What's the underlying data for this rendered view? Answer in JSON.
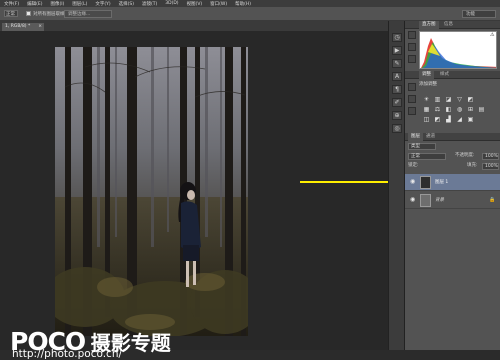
{
  "menu": [
    "文件(F)",
    "编辑(E)",
    "图像(I)",
    "图层(L)",
    "文字(Y)",
    "选择(S)",
    "滤镜(T)",
    "3D(D)",
    "视图(V)",
    "窗口(W)",
    "帮助(H)"
  ],
  "options": {
    "mode_value": "正常",
    "sample_all_layers_label": "对所有图层取样",
    "sample_all_layers_checked": true,
    "refine_button": "调整边缘..."
  },
  "workspace": {
    "selected": "功能"
  },
  "document": {
    "tab_label": "1, RGB/8) *",
    "close_glyph": "×"
  },
  "watermark": {
    "logo": "POCO",
    "subtitle": "摄影专题",
    "url": "http://photo.poco.cn/"
  },
  "annotation": {
    "arrow_color": "#ffee00",
    "points_to": "layer-1"
  },
  "panels": {
    "histogram_tabs": [
      "直方图",
      "信息"
    ],
    "warning_glyph": "⚠",
    "adjustments_tabs": [
      "调整",
      "样式"
    ],
    "adjustments_title": "添加调整",
    "adjust_icons_row1": [
      "☀",
      "▥",
      "◪",
      "▽",
      "◩"
    ],
    "adjust_icons_row2": [
      "▦",
      "⚖",
      "◧",
      "◍",
      "⊞",
      "▤"
    ],
    "adjust_icons_row3": [
      "◫",
      "◩",
      "▟",
      "◢",
      "▣"
    ],
    "layers_tabs": [
      "图层",
      "通道"
    ],
    "kind_label": "类型",
    "blend_mode": "正常",
    "opacity_label": "不透明度:",
    "opacity_value": "100%",
    "lock_label": "锁定:",
    "fill_label": "填充:",
    "fill_value": "100%",
    "layers": [
      {
        "name": "图层 1",
        "selected": true
      },
      {
        "name": "背景",
        "selected": false,
        "locked": true
      }
    ]
  },
  "dock_icons": [
    "history-icon",
    "actions-icon",
    "properties-icon",
    "character-icon",
    "paragraph-icon",
    "brush-icon",
    "clone-source-icon",
    "tool-presets-icon"
  ],
  "dock_glyphs": [
    "◷",
    "▶",
    "✎",
    "A",
    "¶",
    "✐",
    "⊕",
    "◎"
  ],
  "colors": {
    "ui_dark": "#282828",
    "panel": "#535353",
    "selection": "#6b7a96",
    "menubar": "#3c3c3c"
  }
}
